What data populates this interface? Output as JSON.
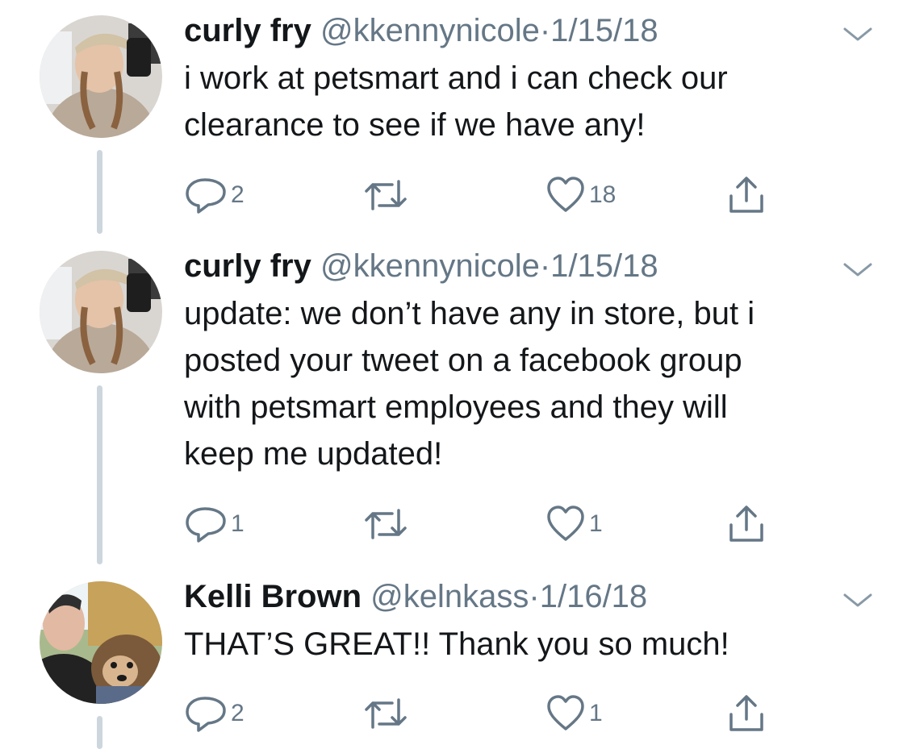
{
  "tweets": [
    {
      "name": "curly fry",
      "handle": "@kkennynicole",
      "separator": "·",
      "date": "1/15/18",
      "text": "i work at petsmart and i can check our\nclearance to see if we have any!",
      "reply_count": "2",
      "retweet_count": "",
      "like_count": "18"
    },
    {
      "name": "curly fry",
      "handle": "@kkennynicole",
      "separator": "·",
      "date": "1/15/18",
      "text": "update: we don’t have any in store, but i\nposted your tweet on a facebook group\nwith petsmart employees and they will\nkeep me updated!",
      "reply_count": "1",
      "retweet_count": "",
      "like_count": "1"
    },
    {
      "name": "Kelli Brown",
      "handle": "@kelnkass",
      "separator": "·",
      "date": "1/16/18",
      "text": "THAT’S GREAT!! Thank you so much!",
      "reply_count": "2",
      "retweet_count": "",
      "like_count": "1"
    }
  ],
  "icons": {
    "reply": "reply-icon",
    "retweet": "retweet-icon",
    "like": "heart-icon",
    "share": "share-icon",
    "menu": "chevron-down-icon"
  },
  "colors": {
    "text": "#14171a",
    "secondary": "#657786",
    "thread_line": "#cdd6dd"
  }
}
